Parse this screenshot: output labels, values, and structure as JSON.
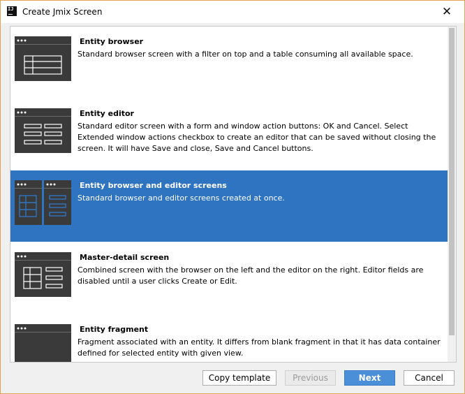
{
  "window": {
    "title": "Create Jmix Screen",
    "app_icon_text": "IJ",
    "close_glyph": "✕"
  },
  "templates": [
    {
      "title": "Entity browser",
      "description": "Standard browser screen with a filter on top and a table consuming all available space.",
      "icon": "browser-template-icon",
      "selected": false
    },
    {
      "title": "Entity editor",
      "description": "Standard editor screen with a form and window action buttons: OK and Cancel. Select Extended window actions checkbox to create an editor that can be saved without closing the screen. It will have Save and close, Save and Cancel buttons.",
      "icon": "editor-template-icon",
      "selected": false
    },
    {
      "title": "Entity browser and editor screens",
      "description": "Standard browser and editor screens created at once.",
      "icon": "browser-editor-template-icon",
      "selected": true
    },
    {
      "title": "Master-detail screen",
      "description": "Combined screen with the browser on the left and the editor on the right. Editor fields are disabled until a user clicks Create or Edit.",
      "icon": "master-detail-template-icon",
      "selected": false
    },
    {
      "title": "Entity fragment",
      "description": "Fragment associated with an entity. It differs from blank fragment in that it has data container defined for selected entity with given view.",
      "icon": "fragment-template-icon",
      "selected": false
    }
  ],
  "buttons": {
    "copy_template": "Copy template",
    "previous": "Previous",
    "next": "Next",
    "cancel": "Cancel"
  },
  "colors": {
    "selection": "#2f74c1",
    "primary_button": "#4a8fd8",
    "thumb_dark": "#3a3a3a",
    "window_border": "#e5a35a"
  }
}
